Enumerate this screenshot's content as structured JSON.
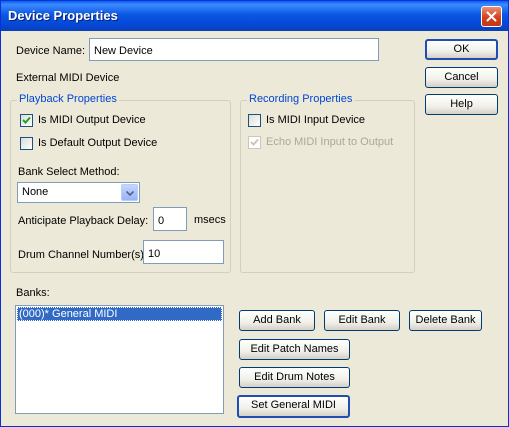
{
  "window": {
    "title": "Device Properties"
  },
  "device_name": {
    "label": "Device Name:",
    "value": "New Device"
  },
  "external_label": "External MIDI Device",
  "buttons": {
    "ok": "OK",
    "cancel": "Cancel",
    "help": "Help"
  },
  "playback": {
    "title": "Playback Properties",
    "is_midi_output": {
      "label": "Is MIDI Output Device",
      "checked": true
    },
    "is_default_output": {
      "label": "Is Default Output Device",
      "checked": false
    },
    "bank_select": {
      "label": "Bank Select Method:",
      "value": "None"
    },
    "anticipate": {
      "label": "Anticipate Playback Delay:",
      "value": "0",
      "unit": "msecs"
    },
    "drum_channel": {
      "label": "Drum Channel Number(s):",
      "value": "10"
    }
  },
  "recording": {
    "title": "Recording Properties",
    "is_midi_input": {
      "label": "Is MIDI Input Device",
      "checked": false
    },
    "echo_midi": {
      "label": "Echo MIDI Input to Output",
      "checked": true,
      "disabled": true
    }
  },
  "banks": {
    "label": "Banks:",
    "items": [
      "(000)* General MIDI"
    ],
    "selected": "(000)* General MIDI"
  },
  "bank_buttons": {
    "add": "Add Bank",
    "edit": "Edit Bank",
    "delete": "Delete Bank",
    "edit_patch": "Edit Patch Names",
    "edit_drum": "Edit Drum Notes",
    "set_gm": "Set General MIDI"
  },
  "icons": {
    "close": "close-icon",
    "check": "checkmark-icon",
    "dropdown": "chevron-down-icon"
  },
  "colors": {
    "titlebar": "#0A5FEF",
    "face": "#ECE9D8",
    "group_title": "#0046D5",
    "selection": "#316AC5"
  }
}
